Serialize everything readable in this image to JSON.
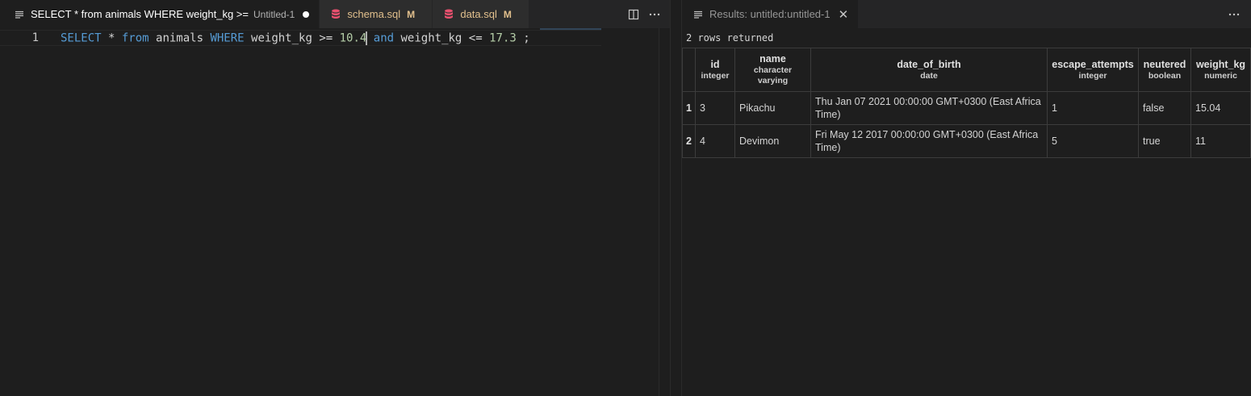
{
  "editor": {
    "tabs": [
      {
        "label": "SELECT * from animals WHERE weight_kg >=",
        "description": "Untitled-1",
        "active": true,
        "dirty": true
      },
      {
        "label": "schema.sql",
        "git_status": "M",
        "active": false
      },
      {
        "label": "data.sql",
        "git_status": "M",
        "active": false
      }
    ],
    "line_number": "1",
    "code_tokens": [
      {
        "text": "SELECT",
        "kind": "keyword"
      },
      {
        "text": " * ",
        "kind": "text"
      },
      {
        "text": "from",
        "kind": "keyword"
      },
      {
        "text": " animals ",
        "kind": "text"
      },
      {
        "text": "WHERE",
        "kind": "keyword"
      },
      {
        "text": " weight_kg >= ",
        "kind": "text"
      },
      {
        "text": "10.4",
        "kind": "number"
      },
      {
        "text": " ",
        "kind": "text"
      },
      {
        "text": "and",
        "kind": "keyword"
      },
      {
        "text": " weight_kg <= ",
        "kind": "text"
      },
      {
        "text": "17.3",
        "kind": "number"
      },
      {
        "text": " ;",
        "kind": "text"
      }
    ],
    "actions": {
      "split_icon": "split-editor-icon",
      "more_icon": "more-actions-icon"
    }
  },
  "results": {
    "tab_label": "Results: untitled:untitled-1",
    "rows_returned": "2 rows returned",
    "columns": [
      {
        "name": "id",
        "type": "integer"
      },
      {
        "name": "name",
        "type": "character varying"
      },
      {
        "name": "date_of_birth",
        "type": "date"
      },
      {
        "name": "escape_attempts",
        "type": "integer"
      },
      {
        "name": "neutered",
        "type": "boolean"
      },
      {
        "name": "weight_kg",
        "type": "numeric"
      }
    ],
    "rows": [
      {
        "num": "1",
        "cells": [
          "3",
          "Pikachu",
          "Thu Jan 07 2021 00:00:00 GMT+0300 (East Africa Time)",
          "1",
          "false",
          "15.04"
        ]
      },
      {
        "num": "2",
        "cells": [
          "4",
          "Devimon",
          "Fri May 12 2017 00:00:00 GMT+0300 (East Africa Time)",
          "5",
          "true",
          "11"
        ]
      }
    ]
  },
  "colors": {
    "keyword": "#569cd6",
    "number": "#b5cea8",
    "git_modified": "#e2c08d",
    "sql_icon": "#e8506e"
  }
}
